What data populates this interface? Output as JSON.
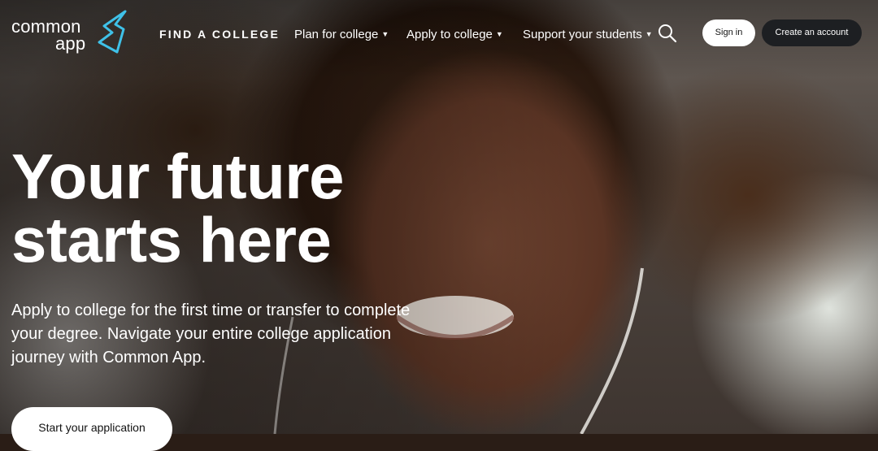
{
  "brand": {
    "logo_line1": "common",
    "logo_line2": "app",
    "accent_color": "#3fc1e8"
  },
  "nav": {
    "find_college": "FIND A COLLEGE",
    "plan": "Plan for college",
    "apply": "Apply to college",
    "support": "Support your students",
    "caret_icon": "triangle-down"
  },
  "header_actions": {
    "search_icon": "search",
    "sign_in": "Sign in",
    "create_account": "Create an account"
  },
  "hero": {
    "headline_line1": "Your future",
    "headline_line2": "starts here",
    "description": "Apply to college for the first time or transfer to complete your degree. Navigate your entire college application journey with Common App.",
    "cta": "Start your application"
  }
}
